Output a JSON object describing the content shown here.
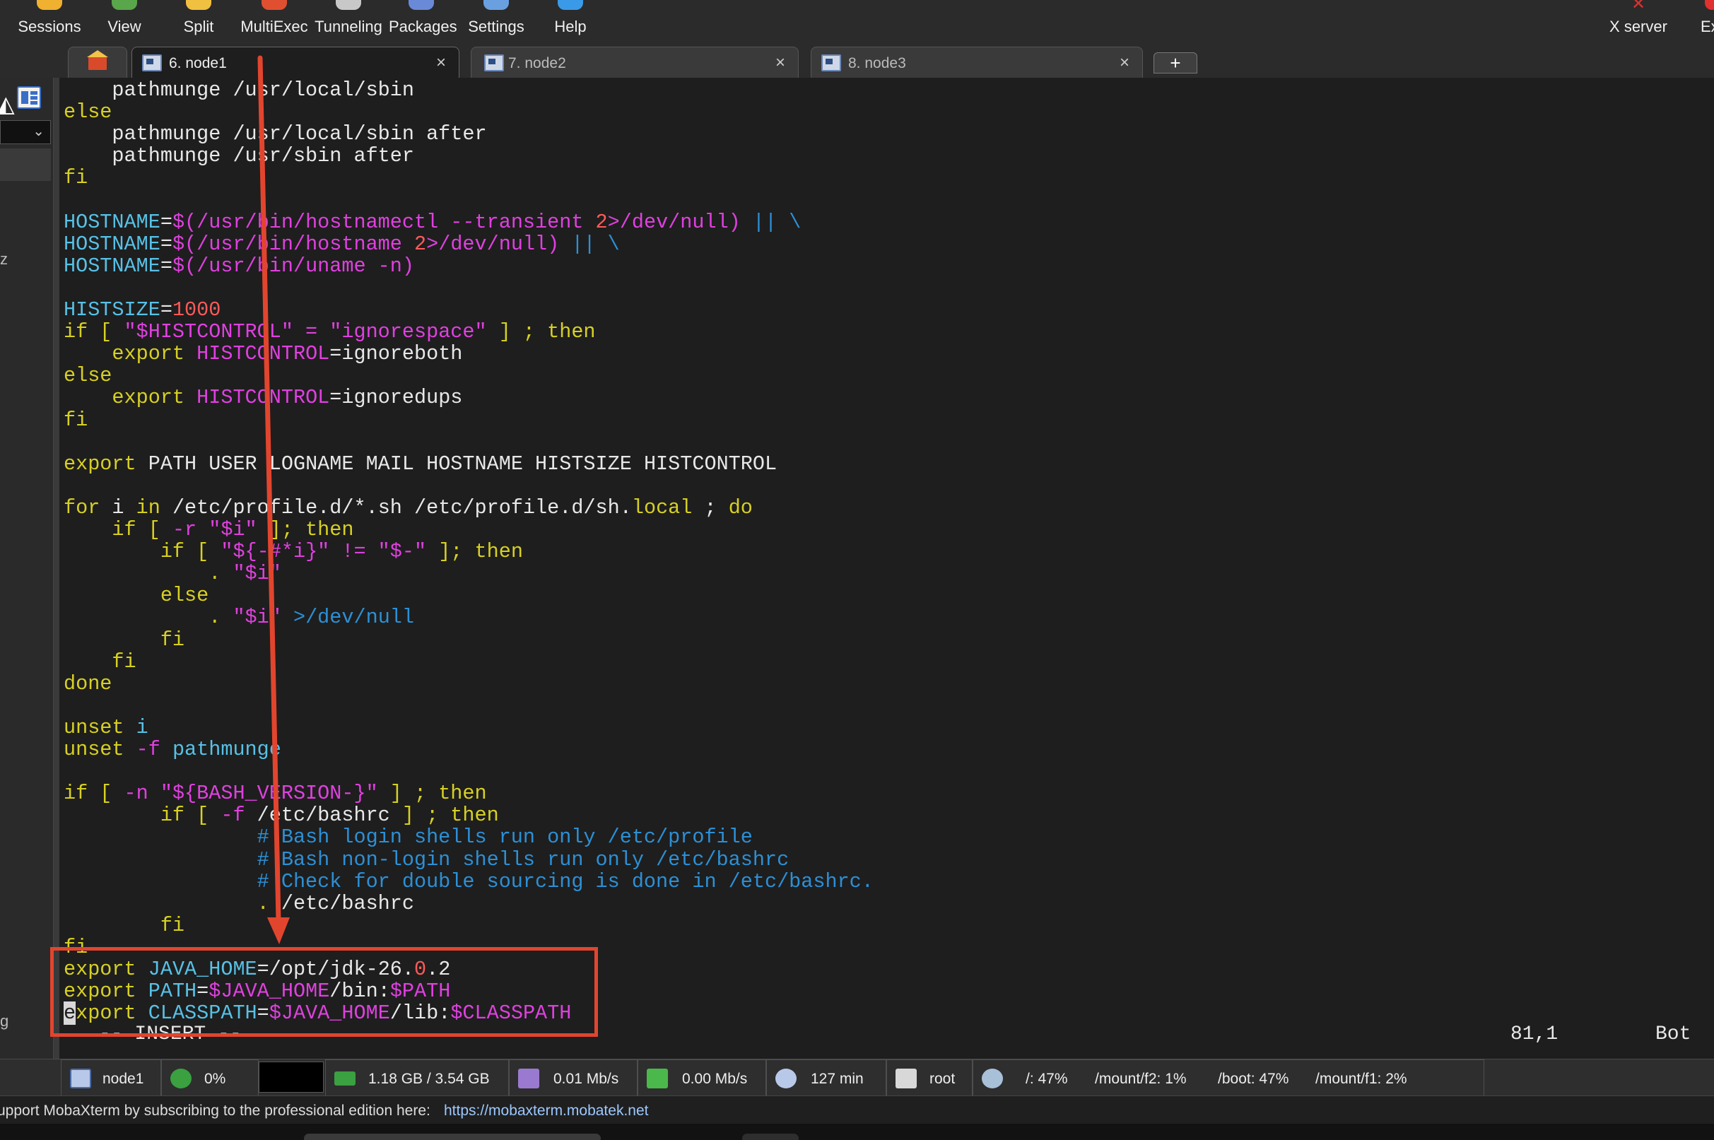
{
  "toolbar": {
    "items": [
      {
        "label": "Sessions",
        "icon": "sessions-icon",
        "color": "#f0b030"
      },
      {
        "label": "View",
        "icon": "view-icon",
        "color": "#5aa64a"
      },
      {
        "label": "Split",
        "icon": "split-icon",
        "color": "#f0c040"
      },
      {
        "label": "MultiExec",
        "icon": "multiexec-icon",
        "color": "#e05030"
      },
      {
        "label": "Tunneling",
        "icon": "tunneling-icon",
        "color": "#c8c8c8"
      },
      {
        "label": "Packages",
        "icon": "packages-icon",
        "color": "#6a8ad8"
      },
      {
        "label": "Settings",
        "icon": "settings-icon",
        "color": "#6aa0e0"
      },
      {
        "label": "Help",
        "icon": "help-icon",
        "color": "#3a9ae8"
      }
    ],
    "x_server_label": "X server",
    "exit_label": "Ex"
  },
  "tabs": [
    {
      "label": "6. node1",
      "close": "×",
      "active": true
    },
    {
      "label": "7. node2",
      "close": "×",
      "active": false
    },
    {
      "label": "8. node3",
      "close": "×",
      "active": false
    }
  ],
  "tab_new_label": "+",
  "sidebar": {
    "fragments": [
      "z",
      "g"
    ],
    "select_chevron": "⌄"
  },
  "terminal": {
    "lines": [
      [
        [
          "    pathmunge /usr/local/sbin",
          "pl"
        ]
      ],
      [
        [
          "else",
          "kw"
        ]
      ],
      [
        [
          "    pathmunge /usr/local/sbin after",
          "pl"
        ]
      ],
      [
        [
          "    pathmunge /usr/sbin after",
          "pl"
        ]
      ],
      [
        [
          "fi",
          "kw"
        ]
      ],
      [],
      [
        [
          "HOSTNAME",
          "var"
        ],
        [
          "=",
          "pl"
        ],
        [
          "$(/usr/bin/hostnamectl --transient ",
          "str"
        ],
        [
          "2",
          "num"
        ],
        [
          ">/dev/null) ",
          "str"
        ],
        [
          "|| \\",
          "cmt"
        ]
      ],
      [
        [
          "HOSTNAME",
          "var"
        ],
        [
          "=",
          "pl"
        ],
        [
          "$(/usr/bin/hostname ",
          "str"
        ],
        [
          "2",
          "num"
        ],
        [
          ">/dev/null) ",
          "str"
        ],
        [
          "|| \\",
          "cmt"
        ]
      ],
      [
        [
          "HOSTNAME",
          "var"
        ],
        [
          "=",
          "pl"
        ],
        [
          "$(/usr/bin/uname -n)",
          "str"
        ]
      ],
      [],
      [
        [
          "HISTSIZE",
          "var"
        ],
        [
          "=",
          "pl"
        ],
        [
          "1000",
          "num"
        ]
      ],
      [
        [
          "if [ ",
          "kw"
        ],
        [
          "\"$HISTCONTROL\" = \"ignorespace\"",
          "str"
        ],
        [
          " ] ; then",
          "kw"
        ]
      ],
      [
        [
          "    export ",
          "kw"
        ],
        [
          "HISTCONTROL",
          "str"
        ],
        [
          "=ignoreboth",
          "pl"
        ]
      ],
      [
        [
          "else",
          "kw"
        ]
      ],
      [
        [
          "    export ",
          "kw"
        ],
        [
          "HISTCONTROL",
          "str"
        ],
        [
          "=ignoredups",
          "pl"
        ]
      ],
      [
        [
          "fi",
          "kw"
        ]
      ],
      [],
      [
        [
          "export ",
          "kw"
        ],
        [
          "PATH USER LOGNAME MAIL HOSTNAME HISTSIZE HISTCONTROL",
          "pl"
        ]
      ],
      [],
      [
        [
          "for ",
          "kw"
        ],
        [
          "i ",
          "pl"
        ],
        [
          "in ",
          "kw"
        ],
        [
          "/etc/profile.d/*.sh /etc/profile.d/sh.",
          "pl"
        ],
        [
          "local",
          "kw"
        ],
        [
          " ; ",
          "pl"
        ],
        [
          "do",
          "kw"
        ]
      ],
      [
        [
          "    if [ ",
          "kw"
        ],
        [
          "-r \"$i\"",
          "str"
        ],
        [
          " ]; then",
          "kw"
        ]
      ],
      [
        [
          "        if [ ",
          "kw"
        ],
        [
          "\"${-#*i}\" != \"$-\"",
          "str"
        ],
        [
          " ]; then",
          "kw"
        ]
      ],
      [
        [
          "            . ",
          "kw"
        ],
        [
          "\"$i\"",
          "str"
        ]
      ],
      [
        [
          "        else",
          "kw"
        ]
      ],
      [
        [
          "            . ",
          "kw"
        ],
        [
          "\"$i\"",
          "str"
        ],
        [
          " >/dev/null",
          "cmt"
        ]
      ],
      [
        [
          "        fi",
          "kw"
        ]
      ],
      [
        [
          "    fi",
          "kw"
        ]
      ],
      [
        [
          "done",
          "kw"
        ]
      ],
      [],
      [
        [
          "unset ",
          "kw"
        ],
        [
          "i",
          "var"
        ]
      ],
      [
        [
          "unset ",
          "kw"
        ],
        [
          "-f ",
          "str"
        ],
        [
          "pathmunge",
          "var"
        ]
      ],
      [],
      [
        [
          "if [ ",
          "kw"
        ],
        [
          "-n \"${BASH_VERSION-}\"",
          "str"
        ],
        [
          " ] ; then",
          "kw"
        ]
      ],
      [
        [
          "        if [ ",
          "kw"
        ],
        [
          "-f ",
          "str"
        ],
        [
          "/etc/bashrc",
          "pl"
        ],
        [
          " ] ; then",
          "kw"
        ]
      ],
      [
        [
          "                # Bash login shells run only /etc/profile",
          "cmt"
        ]
      ],
      [
        [
          "                # Bash non-login shells run only /etc/bashrc",
          "cmt"
        ]
      ],
      [
        [
          "                # Check for double sourcing is done in /etc/bashrc.",
          "cmt"
        ]
      ],
      [
        [
          "                . ",
          "kw"
        ],
        [
          "/etc/bashrc",
          "pl"
        ]
      ],
      [
        [
          "        fi",
          "kw"
        ]
      ],
      [
        [
          "fi",
          "kw"
        ]
      ],
      [
        [
          "export ",
          "kw"
        ],
        [
          "JAVA_HOME",
          "var"
        ],
        [
          "=/opt/jdk-26.",
          "pl"
        ],
        [
          "0",
          "num"
        ],
        [
          ".2",
          "pl"
        ]
      ],
      [
        [
          "export ",
          "kw"
        ],
        [
          "PATH",
          "var"
        ],
        [
          "=",
          "pl"
        ],
        [
          "$JAVA_HOME",
          "str"
        ],
        [
          "/bin:",
          "pl"
        ],
        [
          "$PATH",
          "str"
        ]
      ],
      [
        [
          "e",
          "cursor"
        ],
        [
          "xport ",
          "kw"
        ],
        [
          "CLASSPATH",
          "var"
        ],
        [
          "=",
          "pl"
        ],
        [
          "$JAVA_HOME",
          "str"
        ],
        [
          "/lib:",
          "pl"
        ],
        [
          "$CLASSPATH",
          "str"
        ]
      ]
    ],
    "mode": "-- INSERT --",
    "position": "81,1",
    "scroll": "Bot"
  },
  "annotation": {
    "color": "#e2452e"
  },
  "statusbar": {
    "cells": [
      {
        "label": "node1",
        "icon": "terminal-icon"
      },
      {
        "label": "0%",
        "icon": "cpu-icon"
      },
      {
        "label": "1.18 GB / 3.54 GB",
        "icon": "memory-icon"
      },
      {
        "label": "0.01 Mb/s",
        "icon": "upload-icon"
      },
      {
        "label": "0.00 Mb/s",
        "icon": "download-icon"
      },
      {
        "label": "127 min",
        "icon": "clock-icon"
      },
      {
        "label": "root",
        "icon": "user-icon"
      },
      {
        "label": "/: 47%",
        "icon": "disk-icon"
      },
      {
        "label": "/mount/f2: 1%",
        "icon": ""
      },
      {
        "label": "/boot: 47%",
        "icon": ""
      },
      {
        "label": "/mount/f1: 2%",
        "icon": ""
      }
    ]
  },
  "footer": {
    "message": "upport MobaXterm by subscribing to the professional edition here:",
    "link": "https://mobaxterm.mobatek.net"
  }
}
